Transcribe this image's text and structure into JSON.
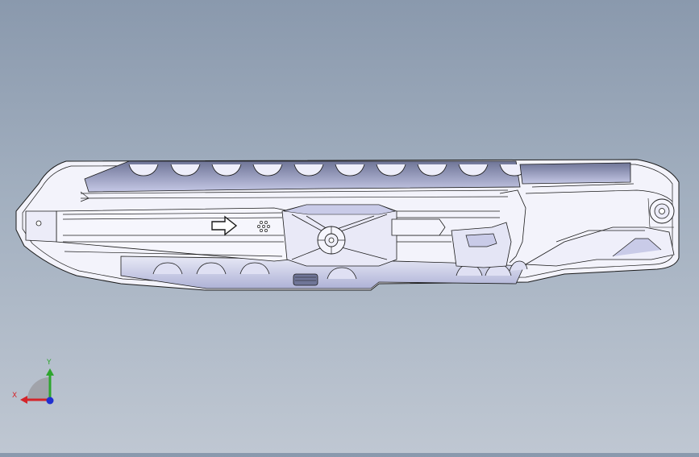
{
  "triad": {
    "x_label": "X",
    "y_label": "Y",
    "x_color": "#d4242a",
    "y_color": "#2ea52e",
    "z_color": "#2030d0"
  },
  "model": {
    "fill_light": "#f2f2fa",
    "fill_shade": "#c9cbe8",
    "fill_dark": "#9ea3cc",
    "edge_color": "#1a1a1a"
  }
}
